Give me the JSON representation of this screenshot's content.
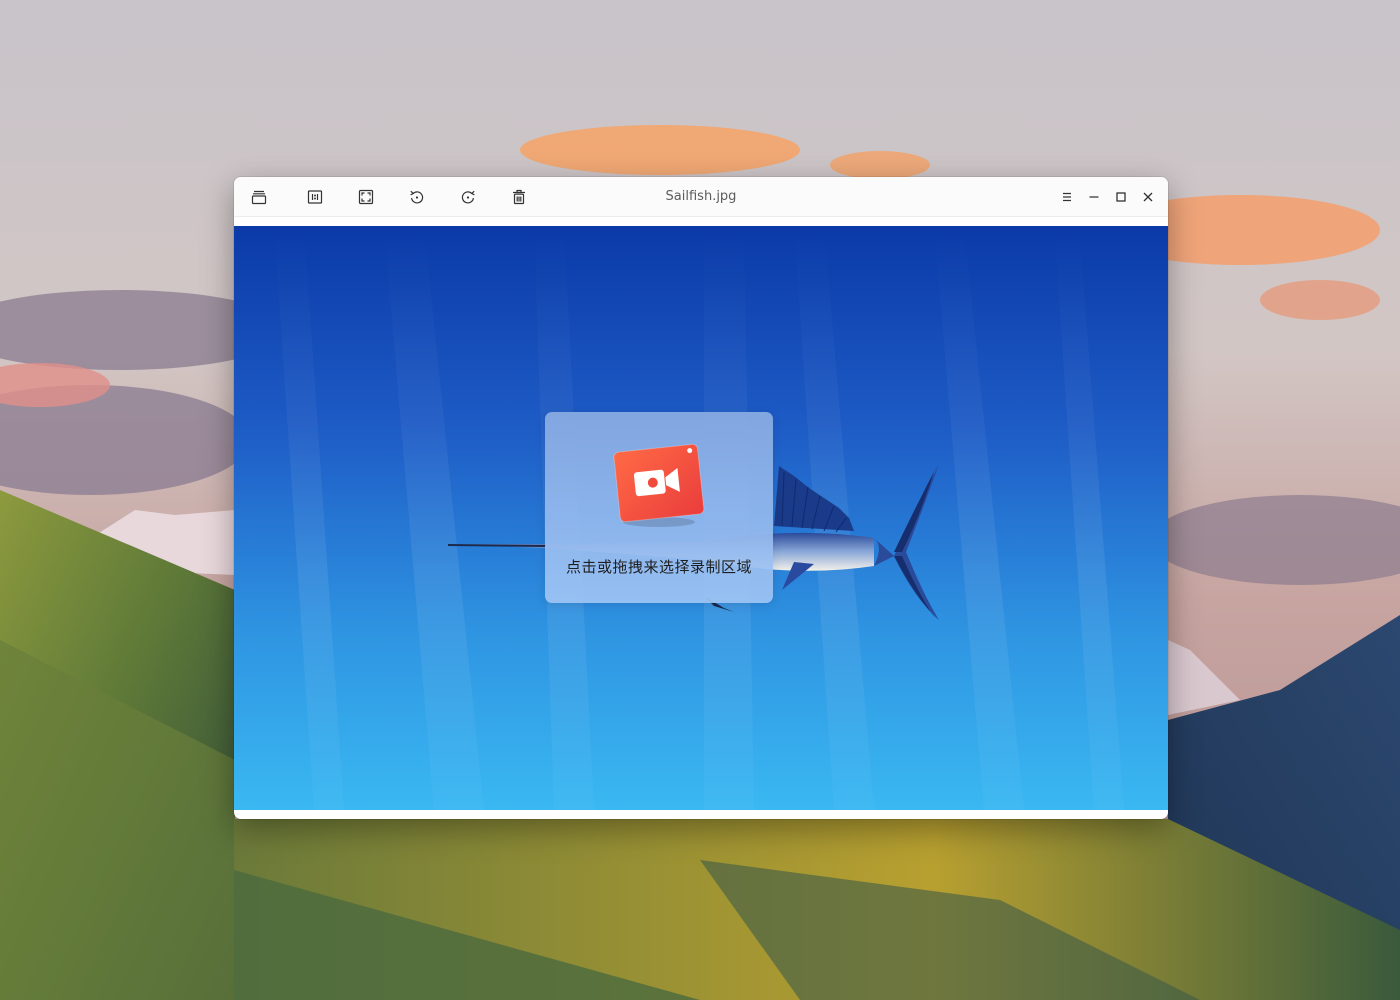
{
  "window": {
    "title": "Sailfish.jpg",
    "toolbar": {
      "icons": [
        "collection-icon",
        "original-size-icon",
        "fit-window-icon",
        "rotate-left-icon",
        "rotate-right-icon",
        "delete-icon"
      ]
    },
    "controls": {
      "icons": [
        "menu-icon",
        "minimize-icon",
        "maximize-icon",
        "close-icon"
      ]
    }
  },
  "recorder": {
    "hint": "点击或拖拽来选择录制区域",
    "accent": "#f2533c"
  },
  "colors": {
    "viewer_top": "#0a3aa8",
    "viewer_bottom": "#3fb8f0",
    "titlebar_bg": "#fbfbfb"
  }
}
